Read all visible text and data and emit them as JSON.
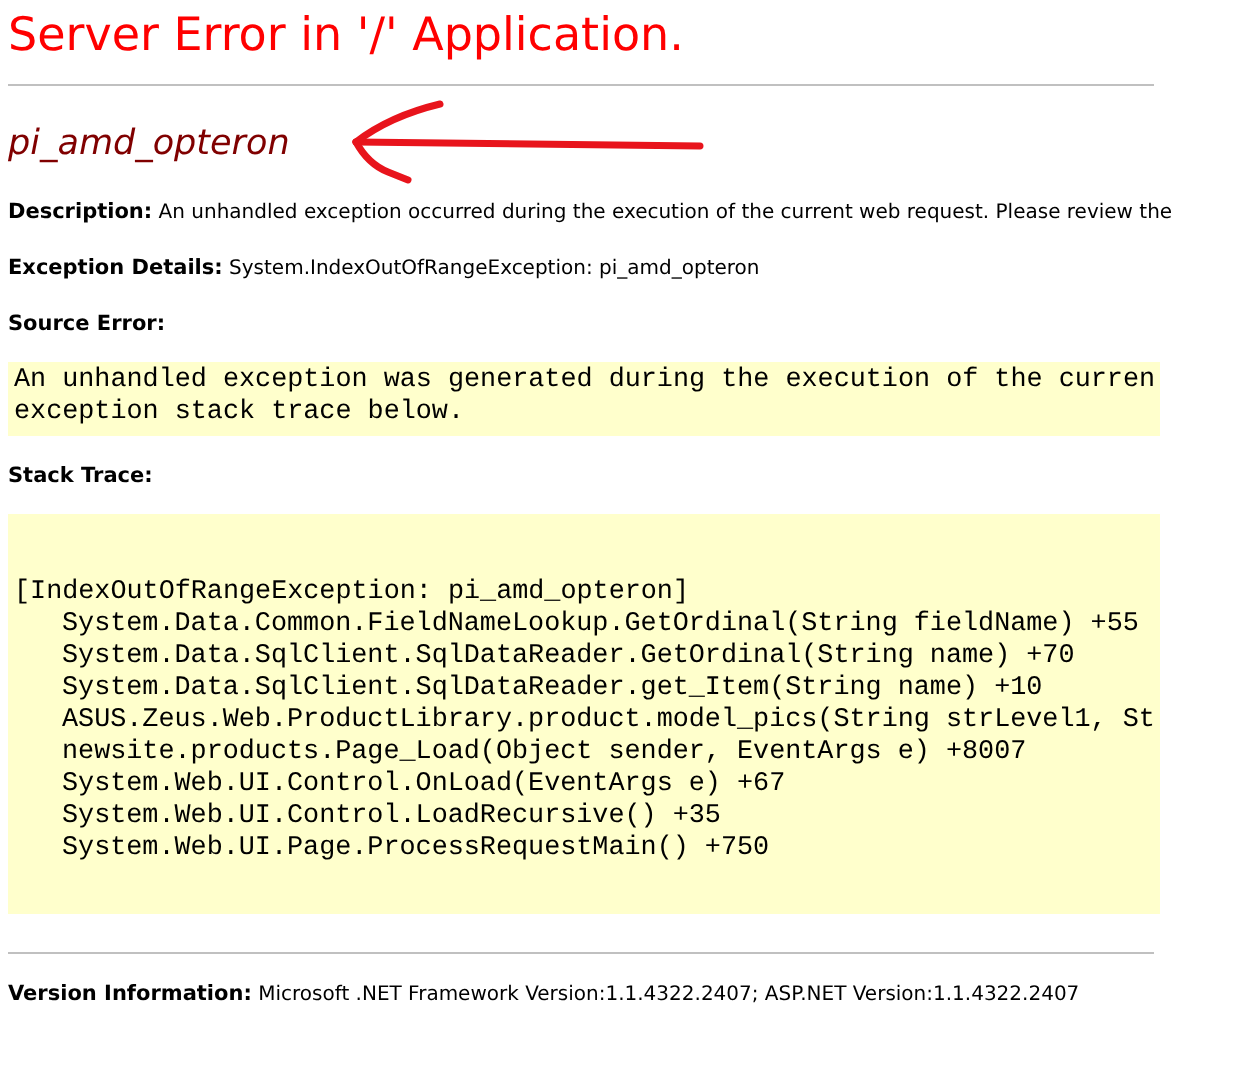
{
  "title": "Server Error in '/' Application.",
  "error_message": "pi_amd_opteron",
  "description": {
    "label": "Description:",
    "text": "An unhandled exception occurred during the execution of the current web request. Please review the"
  },
  "exception_details": {
    "label": "Exception Details:",
    "text": "System.IndexOutOfRangeException: pi_amd_opteron"
  },
  "source_error": {
    "label": "Source Error:",
    "lines": [
      "An unhandled exception was generated during the execution of the curren",
      "exception stack trace below."
    ]
  },
  "stack_trace": {
    "label": "Stack Trace:",
    "exception": "[IndexOutOfRangeException: pi_amd_opteron]",
    "frames": [
      "System.Data.Common.FieldNameLookup.GetOrdinal(String fieldName) +55",
      "System.Data.SqlClient.SqlDataReader.GetOrdinal(String name) +70",
      "System.Data.SqlClient.SqlDataReader.get_Item(String name) +10",
      "ASUS.Zeus.Web.ProductLibrary.product.model_pics(String strLevel1, St",
      "newsite.products.Page_Load(Object sender, EventArgs e) +8007",
      "System.Web.UI.Control.OnLoad(EventArgs e) +67",
      "System.Web.UI.Control.LoadRecursive() +35",
      "System.Web.UI.Page.ProcessRequestMain() +750"
    ]
  },
  "version_info": {
    "label": "Version Information:",
    "text": "Microsoft .NET Framework Version:1.1.4322.2407; ASP.NET Version:1.1.4322.2407"
  }
}
